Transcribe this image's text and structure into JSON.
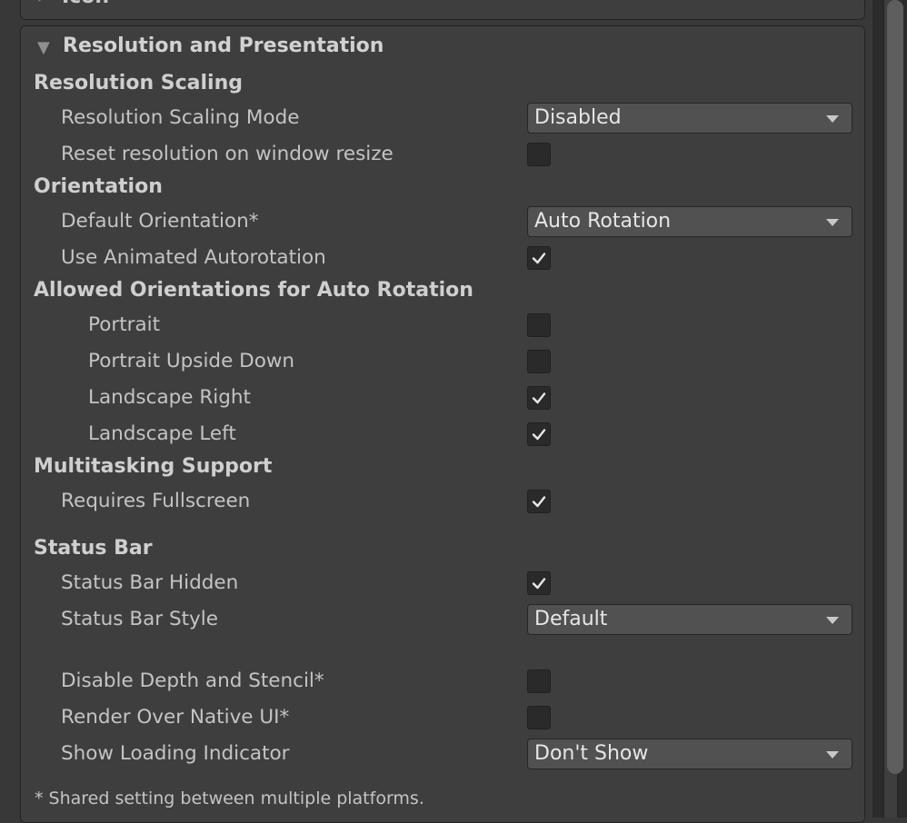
{
  "previous_section": {
    "title": "Icon"
  },
  "section": {
    "title": "Resolution and Presentation"
  },
  "resolution_scaling": {
    "header": "Resolution Scaling",
    "mode_label": "Resolution Scaling Mode",
    "mode_value": "Disabled",
    "reset_label": "Reset resolution on window resize",
    "reset_checked": false
  },
  "orientation": {
    "header": "Orientation",
    "default_label": "Default Orientation*",
    "default_value": "Auto Rotation",
    "animated_label": "Use Animated Autorotation",
    "animated_checked": true
  },
  "allowed": {
    "header": "Allowed Orientations for Auto Rotation",
    "items": [
      {
        "label": "Portrait",
        "checked": false
      },
      {
        "label": "Portrait Upside Down",
        "checked": false
      },
      {
        "label": "Landscape Right",
        "checked": true
      },
      {
        "label": "Landscape Left",
        "checked": true
      }
    ]
  },
  "multitasking": {
    "header": "Multitasking Support",
    "fullscreen_label": "Requires Fullscreen",
    "fullscreen_checked": true
  },
  "status_bar": {
    "header": "Status Bar",
    "hidden_label": "Status Bar Hidden",
    "hidden_checked": true,
    "style_label": "Status Bar Style",
    "style_value": "Default"
  },
  "misc": {
    "depth_label": "Disable Depth and Stencil*",
    "depth_checked": false,
    "native_label": "Render Over Native UI*",
    "native_checked": false,
    "loading_label": "Show Loading Indicator",
    "loading_value": "Don't Show"
  },
  "footnote": "* Shared setting between multiple platforms.",
  "icons": {
    "foldout_collapsed": "chevron-right-icon",
    "foldout_expanded": "chevron-down-icon",
    "check": "checkmark-icon",
    "dropdown": "dropdown-caret-icon"
  }
}
